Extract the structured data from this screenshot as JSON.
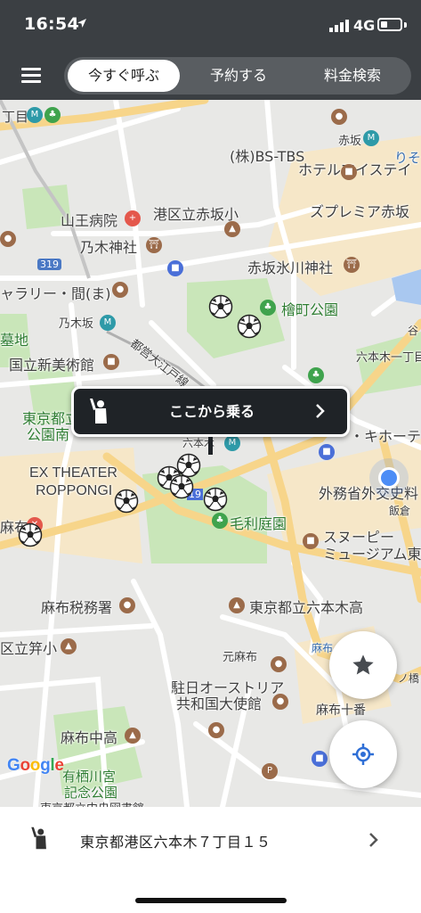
{
  "status_bar": {
    "time": "16:54",
    "network": "4G",
    "battery_level": 0.35
  },
  "header": {
    "tabs": [
      {
        "label": "今すぐ呼ぶ",
        "active": true
      },
      {
        "label": "予約する",
        "active": false
      },
      {
        "label": "料金検索",
        "active": false
      }
    ],
    "colors": {
      "bar": "#3b3f43",
      "tab_track": "#595d61"
    }
  },
  "map": {
    "labels": {
      "l01": "丁目",
      "l02": "赤坂",
      "l03": "りそ",
      "l04": "(株)BS-TBS",
      "l05": "ホテルマイステイ",
      "l06": "ズプレミア赤坂",
      "l07": "山王病院",
      "l08": "港区立赤坂小",
      "l09": "乃木神社",
      "l10": "319",
      "l11": "赤坂氷川神社",
      "l12": "ャラリー・間(ま)",
      "l13": "檜町公園",
      "l14": "乃木坂",
      "l15": "都営大江戸線",
      "l16": "墓地",
      "l17": "国立新美術館",
      "l18": "六本木一丁目",
      "l19": "東京都立",
      "l20": "公園南",
      "l21": "六本木",
      "l22": "・キホーテ",
      "l23": "EX THEATER",
      "l24": "ROPPONGI",
      "l25": "外務省外交史料",
      "l26": "飯倉",
      "l27": "麻布",
      "l28": "毛利庭園",
      "l29": "スヌーピー",
      "l30": "ミュージアム東",
      "l31": "麻布税務署",
      "l32": "東京都立六本木高",
      "l33": "区立笄小",
      "l34": "元麻布",
      "l35": "麻布",
      "l36": "駐日オーストリア",
      "l37": "共和国大使館",
      "l38": "麻布十番",
      "l39": "麻布中高",
      "l40": "有栖川宮",
      "l41": "記念公園",
      "l42": "東京都立中央図書館",
      "l43": "谷",
      "l44": "ノ橋",
      "l45": "19"
    },
    "google_logo": "Google",
    "colors": {
      "park": "#c9e6b9",
      "road": "#ffffff",
      "major_road": "#f7d58a",
      "current_location": "#4c8df6"
    }
  },
  "pickup_button": {
    "label": "ここから乗る"
  },
  "fab": {
    "favorites_icon": "star-icon",
    "locate_icon": "crosshair-icon"
  },
  "bottom": {
    "address": "東京都港区六本木７丁目１５"
  }
}
